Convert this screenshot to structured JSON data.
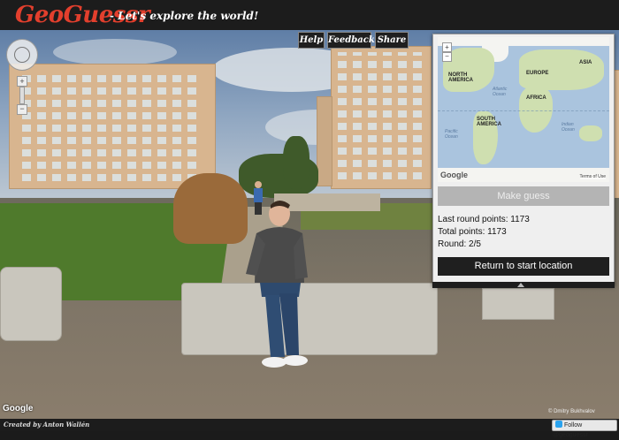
{
  "header": {
    "logo": "GeoGuessr",
    "tagline": "- Let's explore the world!"
  },
  "toolbar": {
    "help_label": "Help",
    "feedback_label": "Feedback",
    "share_label": "Share"
  },
  "street_view": {
    "google_logo": "Google",
    "photo_credit": "© Dmitry Bukhvalov",
    "zoom_in": "+",
    "zoom_out": "−"
  },
  "map": {
    "zoom_in": "+",
    "zoom_out": "−",
    "labels": {
      "north_america": "NORTH AMERICA",
      "europe": "EUROPE",
      "asia": "ASIA",
      "africa": "AFRICA",
      "south_america": "SOUTH AMERICA",
      "atlantic": "Atlantic Ocean",
      "indian": "Indian Ocean",
      "pacific": "Pacific Ocean"
    },
    "google_logo": "Google",
    "terms": "Terms of Use"
  },
  "guess_panel": {
    "make_guess_label": "Make guess",
    "last_round_points": "Last round points: 1173",
    "total_points": "Total points: 1173",
    "round": "Round: 2/5",
    "return_label": "Return to start location"
  },
  "footer": {
    "created_by": "Created by Anton Wallén",
    "follow_label": "Follow @geoguessr"
  },
  "colors": {
    "brand_red": "#e23f2d",
    "header_bg": "#1c1c1c",
    "button_dark": "#1f1f1f",
    "button_disabled": "#b4b4b4"
  }
}
